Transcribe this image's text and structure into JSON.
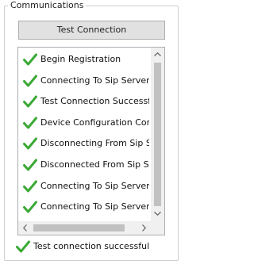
{
  "group": {
    "title": "Communications"
  },
  "test_button": {
    "label": "Test Connection"
  },
  "log": {
    "items": [
      {
        "icon": "green-check-icon",
        "text": "Begin Registration"
      },
      {
        "icon": "green-check-icon",
        "text": "Connecting To Sip Server"
      },
      {
        "icon": "green-check-icon",
        "text": "Test Connection Successful"
      },
      {
        "icon": "green-check-icon",
        "text": "Device Configuration Complete"
      },
      {
        "icon": "green-check-icon",
        "text": "Disconnecting From Sip Server"
      },
      {
        "icon": "green-check-icon",
        "text": "Disconnected From Sip Server"
      },
      {
        "icon": "green-check-icon",
        "text": "Connecting To Sip Server"
      },
      {
        "icon": "green-check-icon",
        "text": "Connecting To Sip Server"
      }
    ]
  },
  "status": {
    "icon": "green-check-icon",
    "text": "Test connection successful"
  },
  "colors": {
    "check": "#3aa935",
    "scrollbar_thumb": "#c1c1c1",
    "button_bg": "#e1e1e1"
  }
}
